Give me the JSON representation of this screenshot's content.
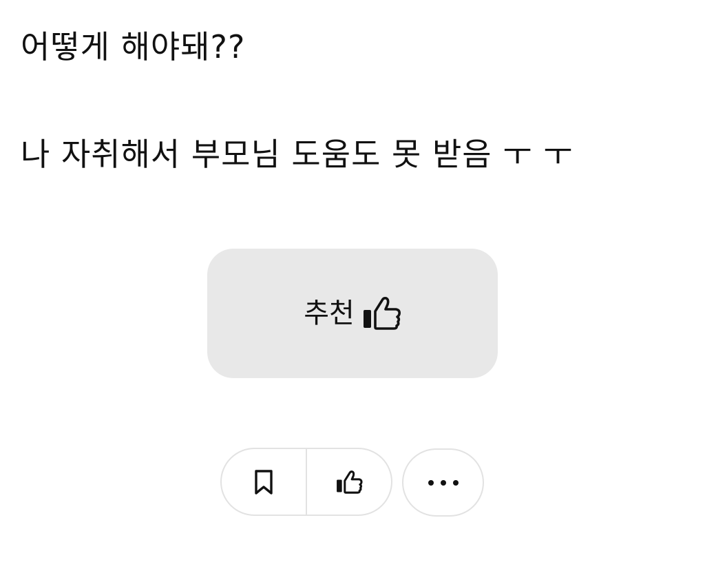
{
  "post": {
    "line1": "어떻게 해야돼??",
    "line2": "나 자취해서 부모님 도움도 못 받음 ㅜ ㅜ"
  },
  "recommend_button": {
    "label": "추천",
    "icon": "thumbs-up-icon"
  },
  "actions": {
    "bookmark_icon": "bookmark-icon",
    "like_icon": "thumbs-up-icon",
    "more_icon": "more-dots-icon"
  },
  "colors": {
    "button_bg": "#e8e8e8",
    "border": "#e2e2e2",
    "text": "#111111"
  }
}
